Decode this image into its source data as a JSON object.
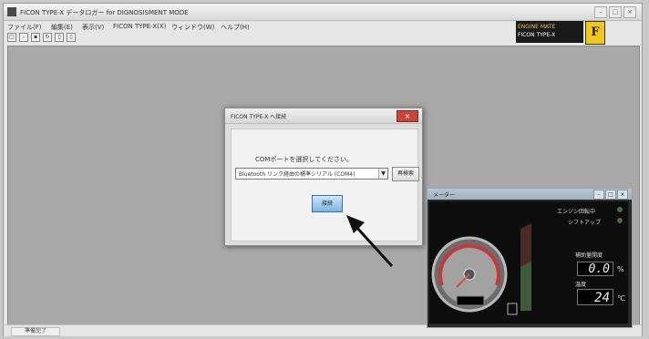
{
  "window": {
    "title": "FICON TYPE-X データロガー for DIGNOSISMENT MODE"
  },
  "menu": [
    "ファイル(F)",
    "編集(E)",
    "表示(V)",
    "FICON TYPE-X(X)",
    "ウィンドウ(W)",
    "ヘルプ(H)"
  ],
  "toolbar": [
    "new-icon",
    "minus-icon",
    "save-icon",
    "refresh-icon",
    "page-icon",
    "page2-icon"
  ],
  "brand": {
    "line1": "ENGINE MATE",
    "line2": "FICON TYPE-X",
    "logo": "F"
  },
  "dialog": {
    "title": "FICON TYPE-X へ接続",
    "prompt": "COMポートを選択してください。",
    "port_value": "Bluetooth リンク経由の標準シリアル (COM4)",
    "refresh_label": "再検索",
    "connect_label": "接続"
  },
  "meter": {
    "title": "メーター",
    "engine_label": "エンジン回転中",
    "sequential_label": "シフトアップ",
    "throttle_label": "補助量開度",
    "throttle_value": "0.0",
    "throttle_unit": "%",
    "temp_label": "温度",
    "temp_value": "24",
    "temp_unit": "℃",
    "rpm_value": "0"
  },
  "status": {
    "text": "準備完了"
  },
  "colors": {
    "gauge_face": "#9a9a9a",
    "redline": "#c43a3a",
    "connect_button": "#7db5e4",
    "close_button": "#c8473a"
  }
}
